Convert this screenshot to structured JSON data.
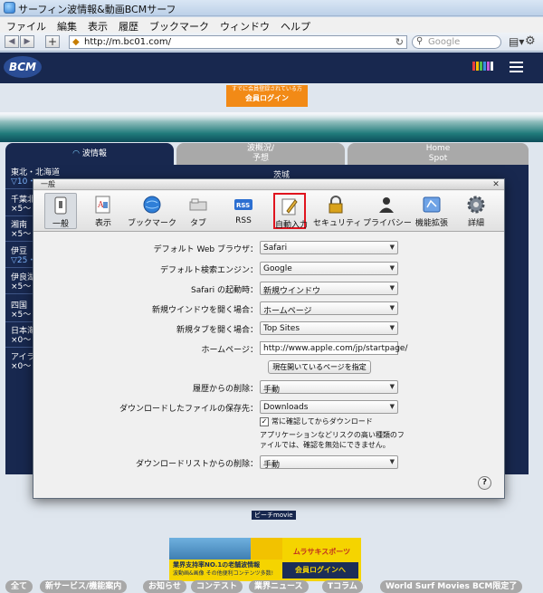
{
  "window": {
    "title": "サーフィン波情報&動画BCMサーフ"
  },
  "menu": [
    "ファイル",
    "編集",
    "表示",
    "履歴",
    "ブックマーク",
    "ウィンドウ",
    "ヘルプ"
  ],
  "toolbar": {
    "url": "http://m.bc01.com/",
    "search_placeholder": "Google"
  },
  "site": {
    "logo": "BCM",
    "login_banner": {
      "line1": "すでに会員登録されている方",
      "line2": "会員ログイン"
    },
    "tabs": [
      {
        "label": "波情報"
      },
      {
        "label": "波概況/\n予想"
      },
      {
        "label": "Home\nSpot"
      }
    ],
    "regions": [
      {
        "name": "東北・北海道",
        "sub": "▽10・"
      },
      {
        "name": "千葉北",
        "sub": "×5〜"
      },
      {
        "name": "湘南",
        "sub": "×5〜"
      },
      {
        "name": "伊豆",
        "sub": "▽25・"
      },
      {
        "name": "伊良湖",
        "sub": "×5〜"
      },
      {
        "name": "四国",
        "sub": "×5〜"
      },
      {
        "name": "日本海",
        "sub": "×0〜"
      },
      {
        "name": "アイラ",
        "sub": "×0〜"
      }
    ],
    "right_region": "茨城",
    "beach_movie": "ビーチmovie",
    "ad_mid": "ムラサキスポーツ",
    "footer_ad": {
      "line1": "業界支持率NO.1の老舗波情報",
      "line2": "波動画&画像 その他便利コンテンツ多数!",
      "button": "会員ログインへ"
    },
    "footer_pills": [
      "全て",
      "新サービス/機能案内",
      "お知らせ",
      "コンテスト",
      "業界ニュース",
      "Tコラム",
      "World Surf Movies BCM限定了"
    ]
  },
  "dialog": {
    "title": "一般",
    "tabs": [
      {
        "label": "一般",
        "icon": "switch-icon"
      },
      {
        "label": "表示",
        "icon": "appearance-icon"
      },
      {
        "label": "ブックマーク",
        "icon": "globe-icon"
      },
      {
        "label": "タブ",
        "icon": "tabs-icon"
      },
      {
        "label": "RSS",
        "icon": "rss-icon"
      },
      {
        "label": "自動入力",
        "icon": "pencil-icon"
      },
      {
        "label": "セキュリティ",
        "icon": "lock-icon"
      },
      {
        "label": "プライバシー",
        "icon": "person-icon"
      },
      {
        "label": "機能拡張",
        "icon": "puzzle-icon"
      },
      {
        "label": "詳細",
        "icon": "gear-icon"
      }
    ],
    "fields": {
      "default_browser": {
        "label": "デフォルト Web ブラウザ：",
        "value": "Safari"
      },
      "default_search": {
        "label": "デフォルト検索エンジン：",
        "value": "Google"
      },
      "on_launch": {
        "label": "Safari の起動時：",
        "value": "新規ウインドウ"
      },
      "new_window": {
        "label": "新規ウインドウを開く場合：",
        "value": "ホームページ"
      },
      "new_tab": {
        "label": "新規タブを開く場合：",
        "value": "Top Sites"
      },
      "homepage": {
        "label": "ホームページ：",
        "value": "http://www.apple.com/jp/startpage/"
      },
      "set_current": "現在開いているページを指定",
      "remove_history": {
        "label": "履歴からの削除：",
        "value": "手動"
      },
      "save_downloads": {
        "label": "ダウンロードしたファイルの保存先：",
        "value": "Downloads"
      },
      "ask_before": "常に確認してからダウンロード",
      "ask_note": "アプリケーションなどリスクの高い種類のファイルでは、確認を無効にできません。",
      "remove_download": {
        "label": "ダウンロードリストからの削除：",
        "value": "手動"
      }
    },
    "help": "?"
  }
}
